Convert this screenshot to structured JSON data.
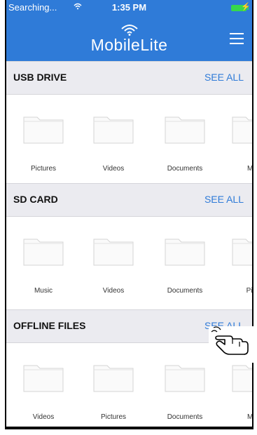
{
  "status": {
    "carrier": "Searching...",
    "time": "1:35 PM"
  },
  "header": {
    "app_name": "MobileLite"
  },
  "see_all_label": "SEE ALL",
  "sections": [
    {
      "title": "USB DRIVE",
      "folders": [
        "Pictures",
        "Videos",
        "Documents",
        "Mu"
      ]
    },
    {
      "title": "SD CARD",
      "folders": [
        "Music",
        "Videos",
        "Documents",
        "Pict"
      ]
    },
    {
      "title": "OFFLINE FILES",
      "folders": [
        "Videos",
        "Pictures",
        "Documents",
        "Mu"
      ]
    }
  ],
  "colors": {
    "primary": "#2f7bd8",
    "section_bg": "#ebebf0",
    "battery": "#36d84d"
  },
  "icons": [
    "wifi-icon",
    "battery-icon",
    "menu-icon",
    "folder-icon",
    "pointer-hand-icon"
  ]
}
